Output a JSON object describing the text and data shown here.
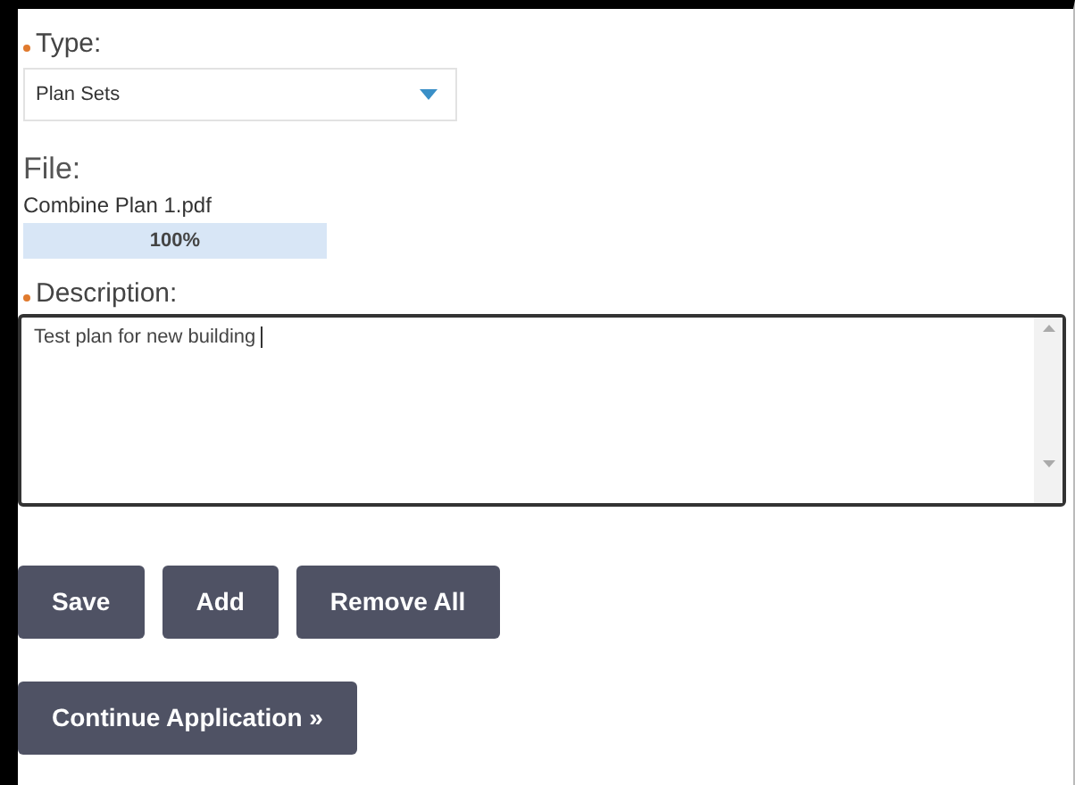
{
  "type_field": {
    "label": "Type:",
    "required": true,
    "value": "Plan Sets"
  },
  "file": {
    "label": "File:",
    "name": "Combine Plan 1.pdf",
    "level": 1,
    "reading": "100%"
  },
  "description": {
    "label": "Description:",
    "required": true,
    "value": "Test plan for new building"
  },
  "buttons": [
    "Save",
    "Add",
    "Remove All"
  ],
  "continue_button": "Continue Application »"
}
